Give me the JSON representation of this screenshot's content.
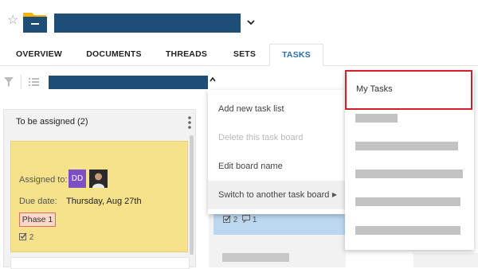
{
  "header": {
    "star_icon": "star-outline-icon",
    "folder_icon": "folder-icon",
    "title_redacted": true,
    "chevron": "⌄"
  },
  "tabs": [
    {
      "label": "OVERVIEW",
      "active": false
    },
    {
      "label": "DOCUMENTS",
      "active": false
    },
    {
      "label": "THREADS",
      "active": false
    },
    {
      "label": "SETS",
      "active": false
    },
    {
      "label": "TASKS",
      "active": true
    }
  ],
  "toolbar": {
    "filter_icon": "filter-icon",
    "list_icon": "list-icon",
    "board_name_redacted": true,
    "chevron": "^"
  },
  "column": {
    "title": "To be assigned (2)",
    "card": {
      "assigned_label": "Assigned to:",
      "assignee_initials": "DD",
      "due_label": "Due date:",
      "due_value": "Thursday, Aug 27th",
      "phase": "Phase 1",
      "checklist_count": "2"
    }
  },
  "middle_card": {
    "checklist_count": "2",
    "comment_count": "1"
  },
  "context_menu": {
    "items": [
      {
        "label": "Add new task list",
        "disabled": false
      },
      {
        "label": "Delete this task board",
        "disabled": true
      },
      {
        "label": "Edit board name",
        "disabled": false
      },
      {
        "label": "Switch to another task board",
        "disabled": false,
        "has_submenu": true
      }
    ],
    "submenu_arrow": "▶"
  },
  "submenu": {
    "first_item": "My Tasks",
    "redacted_items": 5
  },
  "colors": {
    "redaction_blue": "#1e4d78",
    "active_tab": "#2a6db0",
    "card_yellow": "#f7e28c",
    "card_blue": "#bcd8f1",
    "highlight_red": "#d0202a",
    "avatar_purple": "#7d4fc4"
  }
}
